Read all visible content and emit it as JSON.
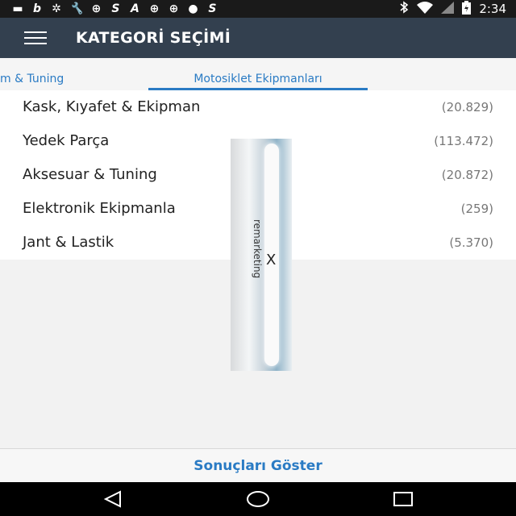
{
  "status_bar": {
    "left_icons": [
      "chat-icon",
      "b-icon",
      "whatsapp-icon",
      "wrench-icon",
      "app-icon",
      "s-icon",
      "a-icon",
      "app-icon",
      "app-icon",
      "chat-icon",
      "s-icon"
    ],
    "left_glyphs": [
      "▬",
      "b",
      "✲",
      "🔧",
      "⊕",
      "S",
      "A",
      "⊕",
      "⊕",
      "●",
      "S"
    ],
    "time": "2:34"
  },
  "app_bar": {
    "title": "KATEGORİ SEÇİMİ"
  },
  "tabs": {
    "previous": "m & Tuning",
    "active": "Motosiklet Ekipmanları"
  },
  "categories": [
    {
      "label": "Kask, Kıyafet & Ekipman",
      "count": "(20.829)"
    },
    {
      "label": "Yedek Parça",
      "count": "(113.472)"
    },
    {
      "label": "Aksesuar & Tuning",
      "count": "(20.872)"
    },
    {
      "label": "Elektronik Ekipmanla",
      "count": "(259)"
    },
    {
      "label": "Jant & Lastik",
      "count": "(5.370)"
    }
  ],
  "overlay": {
    "text": "remarketing",
    "close": "X"
  },
  "footer": {
    "show_results": "Sonuçları Göster"
  },
  "colors": {
    "app_bar": "#33404f",
    "accent": "#2a7bc4",
    "status_bar": "#1a1a1a"
  }
}
